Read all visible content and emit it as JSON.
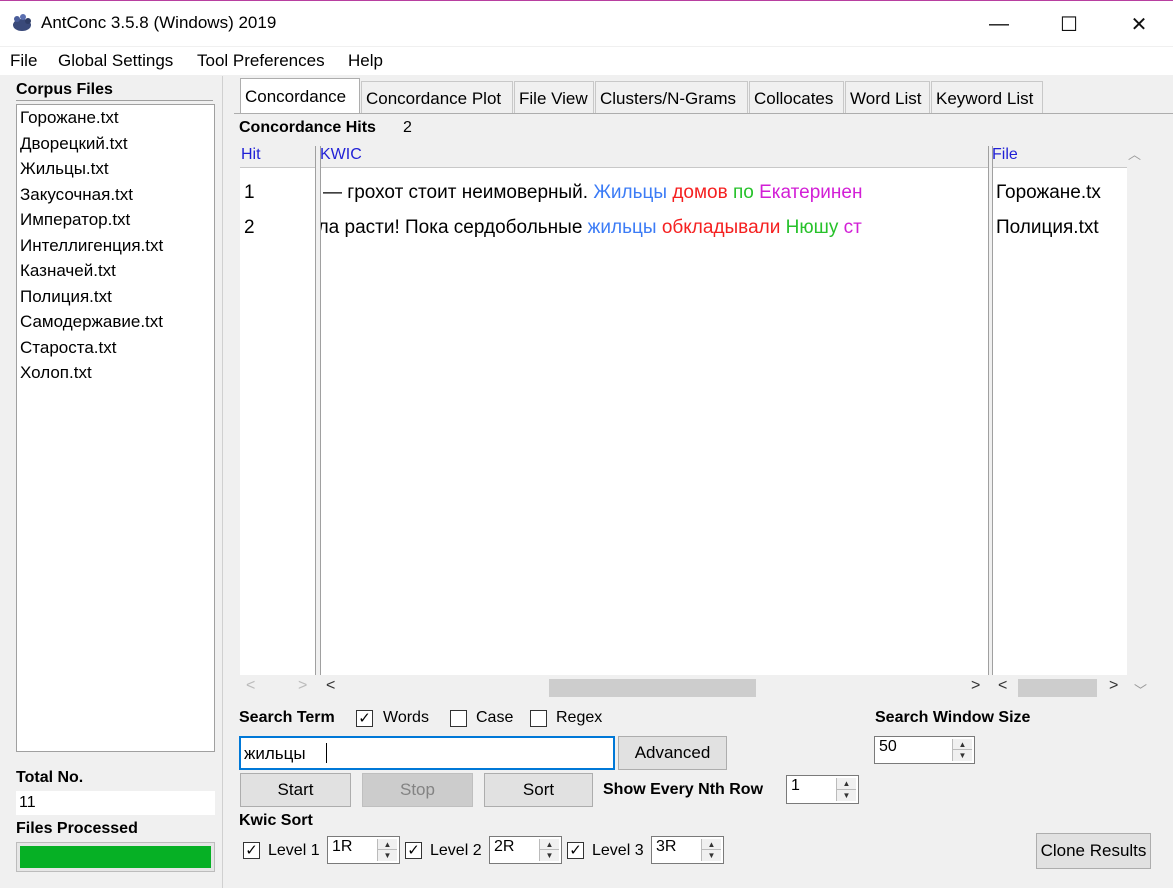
{
  "window": {
    "title": "AntConc 3.5.8 (Windows) 2019",
    "minimize_glyph": "—",
    "maximize_glyph": "☐",
    "close_glyph": "✕"
  },
  "menu": [
    "File",
    "Global Settings",
    "Tool Preferences",
    "Help"
  ],
  "left_panel": {
    "corpus_files_label": "Corpus Files",
    "files": [
      "Горожане.txt",
      "Дворецкий.txt",
      "Жильцы.txt",
      "Закусочная.txt",
      "Император.txt",
      "Интеллигенция.txt",
      "Казначей.txt",
      "Полиция.txt",
      "Самодержавие.txt",
      "Староста.txt",
      "Холоп.txt"
    ],
    "total_no_label": "Total No.",
    "total_no_value": "11",
    "files_processed_label": "Files Processed",
    "progress_fraction": 1.0,
    "progress_color": "#06b025"
  },
  "tabs": [
    "Concordance",
    "Concordance Plot",
    "File View",
    "Clusters/N-Grams",
    "Collocates",
    "Word List",
    "Keyword List"
  ],
  "concordance": {
    "hits_label": "Concordance Hits",
    "hits_value": "2",
    "col_hit": "Hit",
    "col_kwic": "KWIC",
    "col_file": "File",
    "rows": [
      {
        "hit": "1",
        "left": "— грохот стоит неимоверный.",
        "keyword": "Жильцы",
        "r1": "домов",
        "r2": "по",
        "r3": "Екатеринен",
        "file": "Горожане.tx"
      },
      {
        "hit": "2",
        "left": "ала расти! Пока сердобольные",
        "keyword": "жильцы",
        "r1": "обкладывали",
        "r2": "Нюшу",
        "r3": "ст",
        "file": "Полиция.txt"
      }
    ]
  },
  "search": {
    "term_label": "Search Term",
    "words_label": "Words",
    "words_checked": true,
    "case_label": "Case",
    "case_checked": false,
    "regex_label": "Regex",
    "regex_checked": false,
    "term_value": "жильцы",
    "advanced_label": "Advanced",
    "window_size_label": "Search Window Size",
    "window_size_value": "50",
    "start_label": "Start",
    "stop_label": "Stop",
    "sort_label": "Sort",
    "nth_row_label": "Show Every Nth Row",
    "nth_row_value": "1"
  },
  "kwic_sort": {
    "label": "Kwic Sort",
    "levels": [
      {
        "label": "Level 1",
        "value": "1R",
        "checked": true
      },
      {
        "label": "Level 2",
        "value": "2R",
        "checked": true
      },
      {
        "label": "Level 3",
        "value": "3R",
        "checked": true
      }
    ],
    "clone_label": "Clone Results"
  },
  "colors": {
    "keyword": "#3c7cf6",
    "r1": "#f52020",
    "r2": "#27c22b",
    "r3": "#d21fd6",
    "column_header": "#1f1fd6"
  }
}
